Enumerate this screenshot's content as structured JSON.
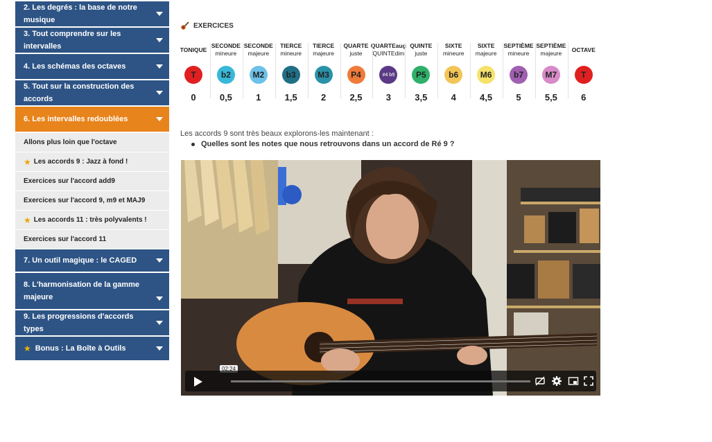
{
  "sidebar": {
    "sections": [
      {
        "label": "2. Les degrés : la base de notre musique"
      },
      {
        "label": "3. Tout comprendre sur les intervalles"
      },
      {
        "label": "4. Les schémas des octaves"
      },
      {
        "label": "5. Tout sur la construction des accords"
      },
      {
        "label": "6. Les intervalles redoublées"
      },
      {
        "label": "7. Un outil magique : le CAGED"
      },
      {
        "label": "8. L'harmonisation de la gamme majeure"
      },
      {
        "label": "9. Les progressions d'accords types"
      },
      {
        "label": "Bonus : La Boîte à Outils"
      }
    ],
    "subitems": [
      {
        "label": "Allons plus loin que l'octave"
      },
      {
        "label": "Les accords 9 : Jazz à fond !"
      },
      {
        "label": "Exercices sur l'accord add9"
      },
      {
        "label": "Exercices sur l'accord 9, m9 et MAJ9"
      },
      {
        "label": "Les accords 11 : très polyvalents !"
      },
      {
        "label": "Exercices sur l'accord 11"
      }
    ]
  },
  "exercises": {
    "heading": "EXERCICES",
    "intervals": [
      {
        "l1": "TONIQUE",
        "l2": "",
        "symbol": "T",
        "value": "0",
        "color": "#e02020"
      },
      {
        "l1": "SECONDE",
        "l2": "mineure",
        "symbol": "b2",
        "value": "0,5",
        "color": "#38b8d8"
      },
      {
        "l1": "SECONDE",
        "l2": "majeure",
        "symbol": "M2",
        "value": "1",
        "color": "#6ec1e8"
      },
      {
        "l1": "TIERCE",
        "l2": "mineure",
        "symbol": "b3",
        "value": "1,5",
        "color": "#1f6f86"
      },
      {
        "l1": "TIERCE",
        "l2": "majeure",
        "symbol": "M3",
        "value": "2",
        "color": "#2a92a8"
      },
      {
        "l1": "QUARTE",
        "l2": "juste",
        "symbol": "P4",
        "value": "2,5",
        "color": "#f07a3a"
      },
      {
        "l1": "QUARTEaug",
        "l2": "QUINTEdim",
        "symbol": "#4 b5",
        "value": "3",
        "color": "#5a3a86"
      },
      {
        "l1": "QUINTE",
        "l2": "juste",
        "symbol": "P5",
        "value": "3,5",
        "color": "#2fb06a"
      },
      {
        "l1": "SIXTE",
        "l2": "mineure",
        "symbol": "b6",
        "value": "4",
        "color": "#f2c656"
      },
      {
        "l1": "SIXTE",
        "l2": "majeure",
        "symbol": "M6",
        "value": "4,5",
        "color": "#f6e26a"
      },
      {
        "l1": "SEPTIÈME",
        "l2": "mineure",
        "symbol": "b7",
        "value": "5",
        "color": "#a05fb0"
      },
      {
        "l1": "SEPTIÈME",
        "l2": "majeure",
        "symbol": "M7",
        "value": "5,5",
        "color": "#d88ac8"
      },
      {
        "l1": "OCTAVE",
        "l2": "",
        "symbol": "T",
        "value": "6",
        "color": "#e02020"
      }
    ]
  },
  "content": {
    "intro": "Les accords 9 sont très beaux explorons-les maintenant :",
    "question": "Quelles sont les notes que nous retrouvons dans un accord de Ré 9 ?"
  },
  "video": {
    "time": "02:24",
    "progress": 0.0
  }
}
